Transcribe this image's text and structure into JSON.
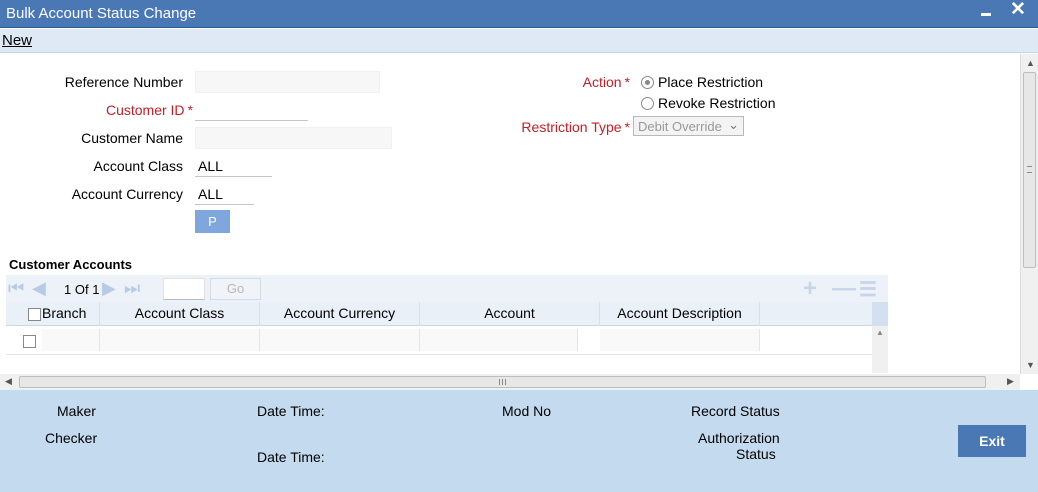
{
  "window": {
    "title": "Bulk Account Status Change",
    "minimize_icon": "minimize-icon",
    "close_label": "✕"
  },
  "menu": {
    "new_label": "New"
  },
  "form": {
    "reference_number": {
      "label": "Reference Number",
      "value": ""
    },
    "customer_id": {
      "label": "Customer ID",
      "required_mark": "*",
      "value": ""
    },
    "customer_name": {
      "label": "Customer Name",
      "value": ""
    },
    "account_class": {
      "label": "Account Class",
      "value": "ALL"
    },
    "account_currency": {
      "label": "Account Currency",
      "value": "ALL"
    },
    "populate_button": "P",
    "action": {
      "label": "Action",
      "required_mark": "*",
      "options": [
        "Place Restriction",
        "Revoke Restriction"
      ],
      "selected": "Place Restriction"
    },
    "restriction_type": {
      "label": "Restriction Type",
      "required_mark": "*",
      "value": "Debit Override"
    }
  },
  "customer_accounts": {
    "title": "Customer Accounts",
    "pager": {
      "current": "1",
      "of_label": "Of",
      "total": "1"
    },
    "go_label": "Go",
    "columns": [
      "Branch",
      "Account Class",
      "Account Currency",
      "Account",
      "Account Description"
    ],
    "rows": [
      {
        "branch": "",
        "account_class": "",
        "account_currency": "",
        "account": "",
        "account_description": ""
      }
    ]
  },
  "footer": {
    "maker_label": "Maker",
    "checker_label": "Checker",
    "date_time_label": "Date Time:",
    "mod_no_label": "Mod No",
    "record_status_label": "Record Status",
    "authorization_label": "Authorization",
    "status_label": "Status",
    "exit_label": "Exit"
  },
  "colors": {
    "title_bar": "#4a78b5",
    "required": "#c0202a",
    "footer": "#c4daee"
  }
}
